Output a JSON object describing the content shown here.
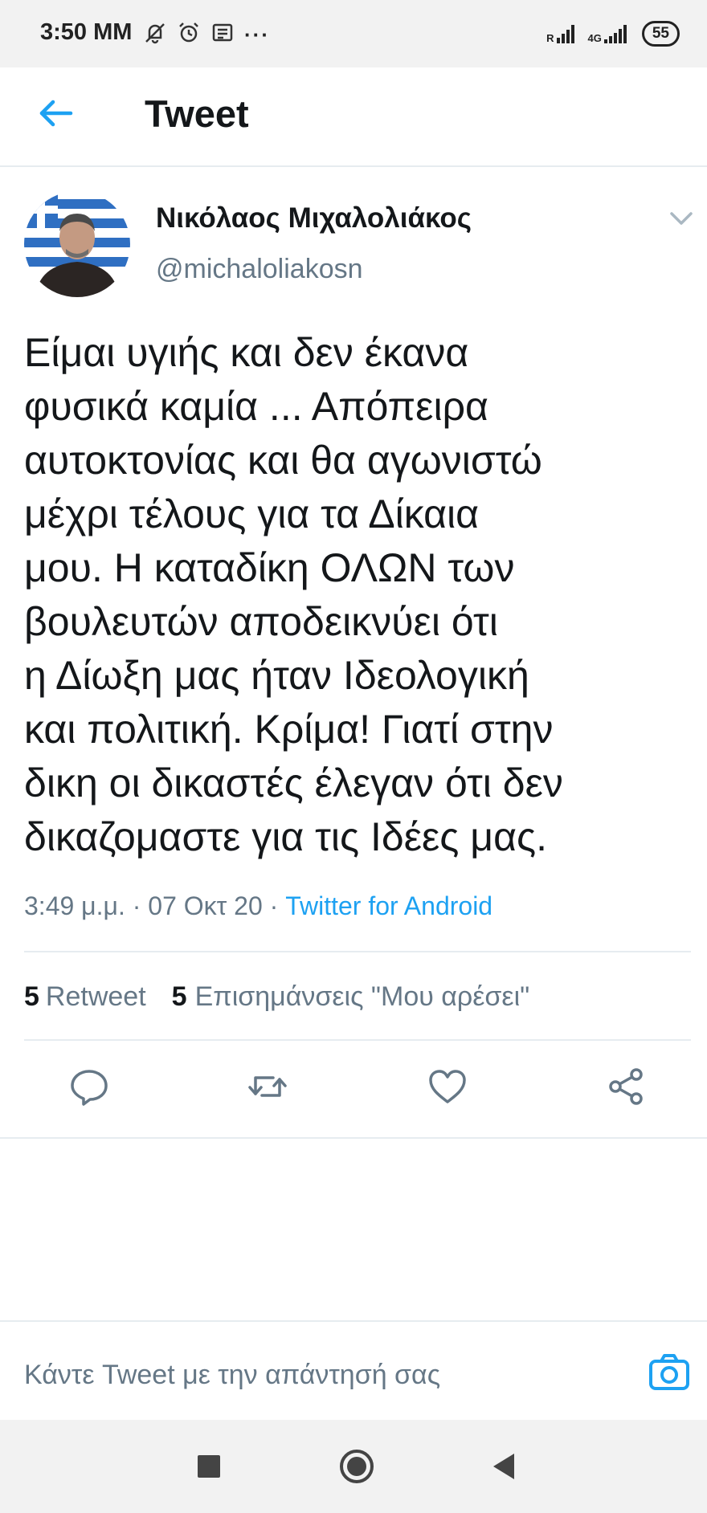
{
  "status_bar": {
    "time": "3:50 MM",
    "more": "···",
    "sim1_label": "R",
    "sim2_label": "4G",
    "battery": "55",
    "icons": [
      "muted-bell-icon",
      "alarm-icon",
      "message-icon",
      "signal-icon",
      "signal-icon",
      "battery-icon"
    ]
  },
  "header": {
    "title": "Tweet",
    "back_icon": "arrow-left-icon"
  },
  "tweet": {
    "author_name": "Νικόλαος Μιχαλολιάκος",
    "author_handle": "@michaloliakosn",
    "text": "Είμαι υγιής και δεν έκανα\nφυσικά καμία ... Απόπειρα\nαυτοκτονίας και θα αγωνιστώ\nμέχρι τέλους για τα Δίκαια\nμου. Η καταδίκη ΟΛΩΝ των\nβουλευτών αποδεικνύει ότι\nη Δίωξη μας ήταν Ιδεολογική\nκαι πολιτική. Κρίμα! Γιατί στην\nδικη οι δικαστές έλεγαν ότι δεν\nδικαζομαστε για τις Ιδέες μας.",
    "time": "3:49 μ.μ.",
    "separator": "·",
    "date": "07 Οκτ 20",
    "source": "Twitter for Android",
    "retweet_count": "5",
    "retweet_label": "Retweet",
    "like_count": "5",
    "like_label": "Επισημάνσεις \"Μου αρέσει\""
  },
  "actions": [
    "reply-icon",
    "retweet-icon",
    "heart-icon",
    "share-icon"
  ],
  "reply": {
    "placeholder": "Κάντε Tweet με την απάντησή σας",
    "camera_icon": "camera-icon"
  },
  "colors": {
    "accent": "#1da1f2",
    "secondary_text": "#657786",
    "divider": "#e6ecf0"
  }
}
